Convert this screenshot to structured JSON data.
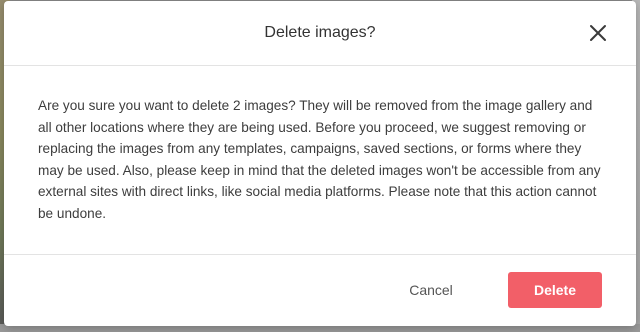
{
  "dialog": {
    "title": "Delete images?",
    "message": "Are you sure you want to delete 2 images? They will be removed from the image gallery and all other locations where they are being used. Before you proceed, we suggest removing or replacing the images from any templates, campaigns, saved sections, or forms where they may be used. Also, please keep in mind that the deleted images won't be accessible from any external sites with direct links, like social media platforms. Please note that this action cannot be undone.",
    "close_icon": "close-icon",
    "cancel_label": "Cancel",
    "delete_label": "Delete"
  },
  "colors": {
    "delete_button": "#f25f68",
    "overlay": "#7a7a7a",
    "title_text": "#333333",
    "body_text": "#3d3d3d"
  }
}
